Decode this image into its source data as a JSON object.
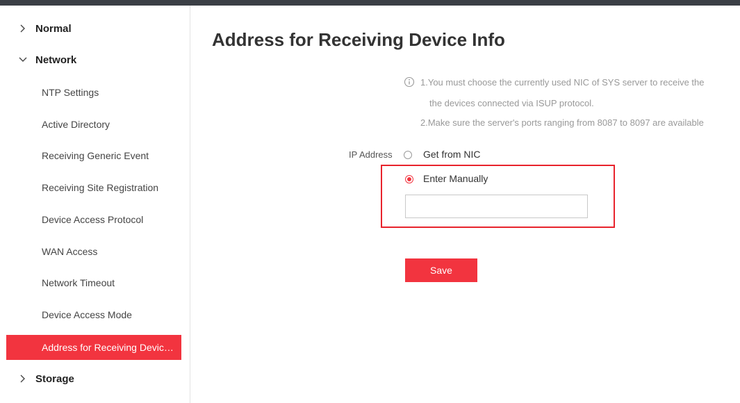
{
  "sidebar": {
    "groups": [
      {
        "label": "Normal",
        "expanded": false,
        "icon": "chevron-right-icon"
      },
      {
        "label": "Network",
        "expanded": true,
        "icon": "chevron-down-icon"
      },
      {
        "label": "Storage",
        "expanded": false,
        "icon": "chevron-right-icon"
      }
    ],
    "items": [
      {
        "label": "NTP Settings"
      },
      {
        "label": "Active Directory"
      },
      {
        "label": "Receiving Generic Event"
      },
      {
        "label": "Receiving Site Registration"
      },
      {
        "label": "Device Access Protocol"
      },
      {
        "label": "WAN Access"
      },
      {
        "label": "Network Timeout"
      },
      {
        "label": "Device Access Mode"
      },
      {
        "label": "Address for Receiving Device...",
        "active": true
      }
    ]
  },
  "main": {
    "title": "Address for Receiving Device Info",
    "notes": {
      "line1": "1.You must choose the currently used NIC of SYS server to receive the",
      "line2": "the devices connected via ISUP protocol.",
      "line3": "2.Make sure the server's ports ranging from 8087 to 8097 are available"
    },
    "ip_address": {
      "label": "IP Address",
      "options": [
        {
          "label": "Get from NIC",
          "checked": false
        },
        {
          "label": "Enter Manually",
          "checked": true
        }
      ],
      "value": "",
      "placeholder": ""
    },
    "save_label": "Save"
  },
  "colors": {
    "accent": "#f2343f",
    "highlight_border": "#e8232c",
    "topbar": "#3b3f45",
    "note_text": "#999999"
  }
}
